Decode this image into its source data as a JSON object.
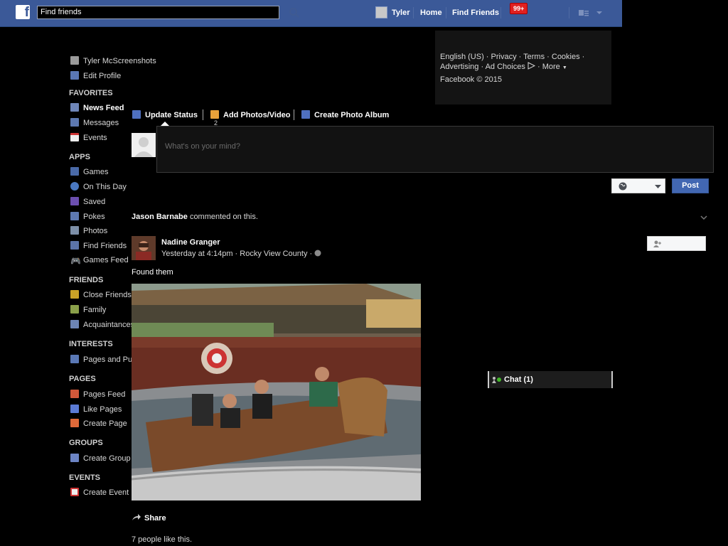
{
  "topbar": {
    "search_value": "Find friends",
    "user_name": "Tyler",
    "home": "Home",
    "find_friends": "Find Friends",
    "notif_badge": "99+",
    "brand_color": "#3b5998"
  },
  "footer": {
    "line1": "English (US) · Privacy · Terms · Cookies ·",
    "line2_a": "Advertising · Ad Choices",
    "line2_b": "· More",
    "copyright": "Facebook © 2015"
  },
  "sidebar": {
    "profile_name": "Tyler McScreenshots",
    "edit_profile": "Edit Profile",
    "favorites_header": "FAVORITES",
    "favorites": [
      "News Feed",
      "Messages",
      "Events"
    ],
    "apps_header": "APPS",
    "apps": [
      "Games",
      "On This Day",
      "Saved",
      "Pokes",
      "Photos",
      "Find Friends",
      "Games Feed"
    ],
    "friends_header": "FRIENDS",
    "friends": [
      "Close Friends",
      "Family",
      "Acquaintances"
    ],
    "interests_header": "INTERESTS",
    "interests": [
      "Pages and Pu"
    ],
    "pages_header": "PAGES",
    "pages": [
      "Pages Feed",
      "Like Pages",
      "Create Page"
    ],
    "groups_header": "GROUPS",
    "groups": [
      "Create Group"
    ],
    "events_header": "EVENTS",
    "events": [
      "Create Event"
    ]
  },
  "composer": {
    "update_status": "Update Status",
    "add_photos": "Add Photos/Video",
    "add_photos_count": "2",
    "create_album": "Create Photo Album",
    "placeholder": "What's on your mind?",
    "post": "Post"
  },
  "story": {
    "context_name": "Jason Barnabe",
    "context_text": "commented on this.",
    "author": "Nadine Granger",
    "meta": "Yesterday at 4:14pm · Rocky View County ·",
    "text": "Found them",
    "share": "Share",
    "likes": "7 people like this."
  },
  "chat": {
    "label": "Chat (1)"
  }
}
